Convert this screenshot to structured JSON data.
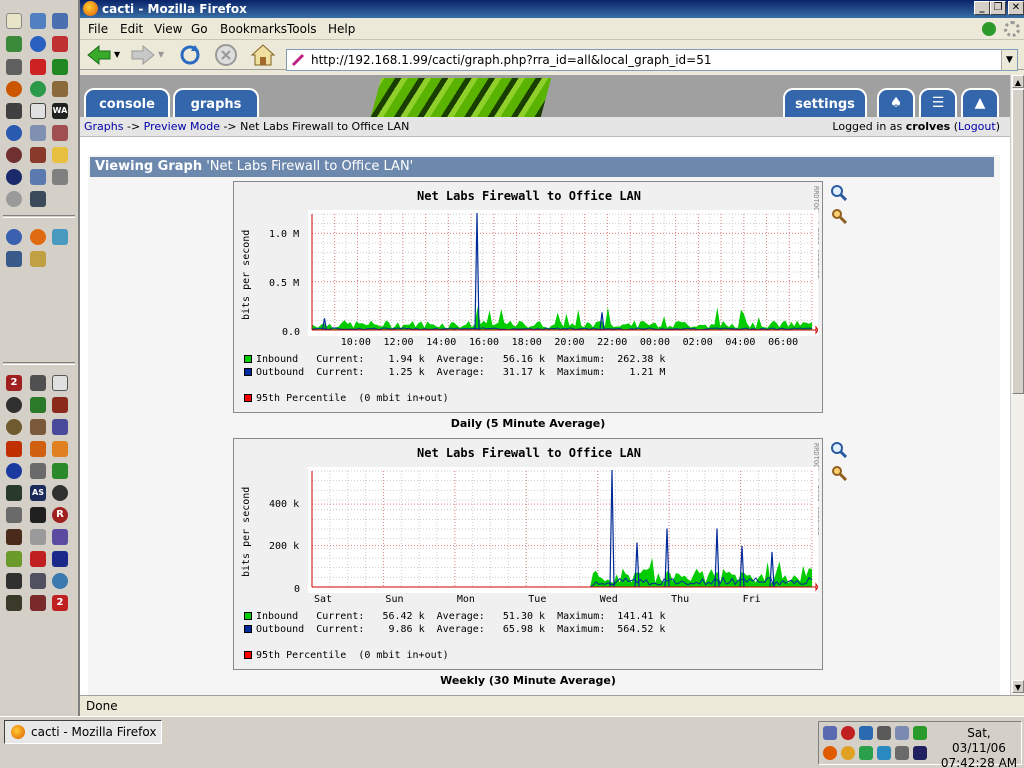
{
  "window": {
    "title": "cacti - Mozilla Firefox"
  },
  "menu": [
    "File",
    "Edit",
    "View",
    "Go",
    "Bookmarks",
    "Tools",
    "Help"
  ],
  "address": {
    "url": "http://192.168.1.99/cacti/graph.php?rra_id=all&local_graph_id=51"
  },
  "tabs": {
    "console": "console",
    "graphs": "graphs",
    "settings": "settings"
  },
  "breadcrumb": {
    "graphs": "Graphs",
    "sep1": " -> ",
    "preview": "Preview Mode",
    "sep2": " -> ",
    "current": "Net Labs Firewall to Office LAN"
  },
  "login": {
    "prefix": "Logged in as ",
    "user": "crolves",
    "logout": "Logout"
  },
  "panel": {
    "heading_bold": "Viewing Graph",
    "heading_name": " 'Net Labs Firewall to Office LAN'"
  },
  "colors": {
    "inbound": "#00cc00",
    "outbound": "#002a97",
    "percentile": "#ff0000",
    "tab_blue": "#3366aa"
  },
  "graphs": [
    {
      "title": "Net Labs Firewall to Office LAN",
      "ylabel": "bits per second",
      "rrdtool_label": "RRDTOOL / TOBI OETIKER",
      "caption": "Daily (5 Minute Average)",
      "y_ticks": [
        "1.0 M",
        "0.5 M",
        "0.0"
      ],
      "x_ticks": [
        "10:00",
        "12:00",
        "14:00",
        "16:00",
        "18:00",
        "20:00",
        "22:00",
        "00:00",
        "02:00",
        "04:00",
        "06:00"
      ],
      "legend": [
        {
          "name": "Inbound ",
          "current": "1.94 k",
          "average": "56.16 k",
          "maximum": "262.38 k"
        },
        {
          "name": "Outbound",
          "current": "1.25 k",
          "average": "31.17 k",
          "maximum": "1.21 M"
        }
      ],
      "percentile": "95th Percentile  (0 mbit in+out)"
    },
    {
      "title": "Net Labs Firewall to Office LAN",
      "ylabel": "bits per second",
      "rrdtool_label": "RRDTOOL / TOBI OETIKER",
      "caption": "Weekly (30 Minute Average)",
      "y_ticks": [
        "400 k",
        "200 k",
        "0"
      ],
      "x_ticks": [
        "Sat",
        "Sun",
        "Mon",
        "Tue",
        "Wed",
        "Thu",
        "Fri"
      ],
      "legend": [
        {
          "name": "Inbound ",
          "current": "56.42 k",
          "average": "51.30 k",
          "maximum": "141.41 k"
        },
        {
          "name": "Outbound",
          "current": "9.86 k",
          "average": "65.98 k",
          "maximum": "564.52 k"
        }
      ],
      "percentile": "95th Percentile  (0 mbit in+out)"
    }
  ],
  "chart_data": [
    {
      "type": "area",
      "title": "Net Labs Firewall to Office LAN",
      "ylabel": "bits per second",
      "x": [
        "10:00",
        "12:00",
        "14:00",
        "16:00",
        "18:00",
        "20:00",
        "22:00",
        "00:00",
        "02:00",
        "04:00",
        "06:00"
      ],
      "ylim": [
        0,
        1200000
      ],
      "series": [
        {
          "name": "Inbound",
          "peak": 262380,
          "average": 56160
        },
        {
          "name": "Outbound",
          "peak": 1210000,
          "average": 31170,
          "peak_at": "16:00"
        }
      ]
    },
    {
      "type": "area",
      "title": "Net Labs Firewall to Office LAN",
      "ylabel": "bits per second",
      "x": [
        "Sat",
        "Sun",
        "Mon",
        "Tue",
        "Wed",
        "Thu",
        "Fri"
      ],
      "ylim": [
        0,
        560000
      ],
      "series": [
        {
          "name": "Inbound",
          "peak": 141410,
          "average": 51300
        },
        {
          "name": "Outbound",
          "peak": 564520,
          "average": 65980,
          "peak_at": "Wed"
        }
      ]
    }
  ],
  "status": {
    "text": "Done"
  },
  "taskbar": {
    "task_label": "cacti - Mozilla Firefox",
    "date": "Sat, 03/11/06",
    "time": "07:42:28 AM"
  }
}
